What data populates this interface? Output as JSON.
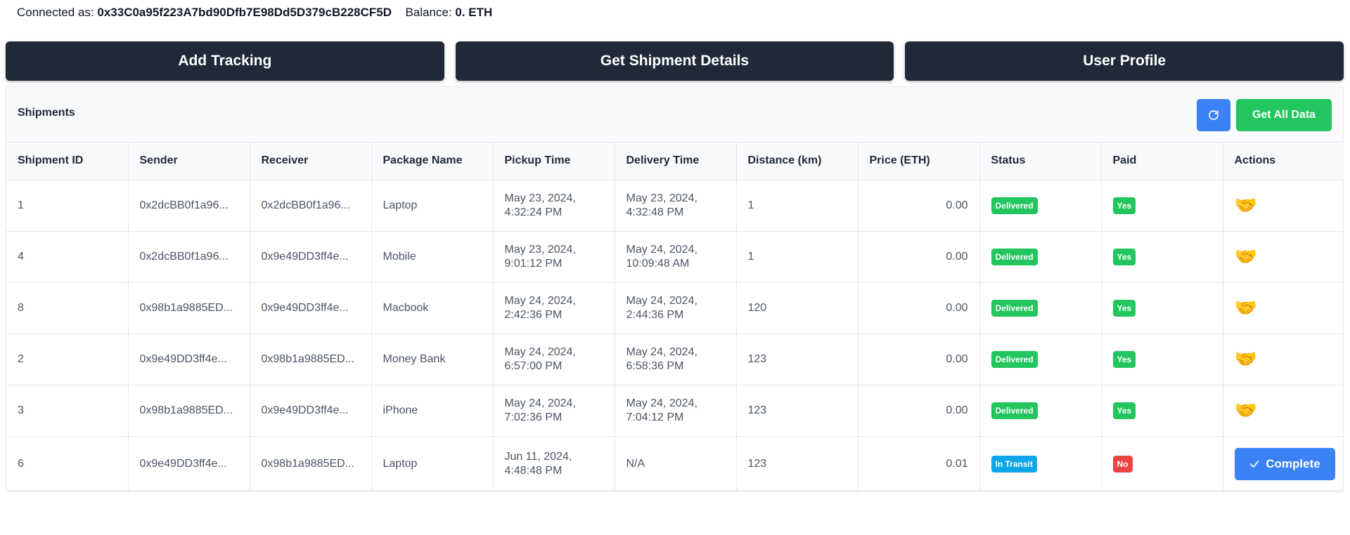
{
  "header": {
    "connected_label": "Connected as:",
    "address": "0x33C0a95f223A7bd90Dfb7E98Dd5D379cB228CF5D",
    "balance_label": "Balance:",
    "balance": "0. ETH"
  },
  "nav": {
    "add_tracking": "Add Tracking",
    "get_shipment_details": "Get Shipment Details",
    "user_profile": "User Profile"
  },
  "panel": {
    "title": "Shipments",
    "refresh_icon": "refresh-icon",
    "get_all_label": "Get All Data"
  },
  "table": {
    "headers": [
      "Shipment ID",
      "Sender",
      "Receiver",
      "Package Name",
      "Pickup Time",
      "Delivery Time",
      "Distance (km)",
      "Price (ETH)",
      "Status",
      "Paid",
      "Actions"
    ],
    "rows": [
      {
        "id": "1",
        "sender": "0x2dcBB0f1a96...",
        "receiver": "0x2dcBB0f1a96...",
        "package": "Laptop",
        "pickup": "May 23, 2024, 4:32:24 PM",
        "delivery": "May 23, 2024, 4:32:48 PM",
        "distance": "1",
        "price": "0.00",
        "status": "Delivered",
        "paid": "Yes",
        "action": "🤝"
      },
      {
        "id": "4",
        "sender": "0x2dcBB0f1a96...",
        "receiver": "0x9e49DD3ff4e...",
        "package": "Mobile",
        "pickup": "May 23, 2024, 9:01:12 PM",
        "delivery": "May 24, 2024, 10:09:48 AM",
        "distance": "1",
        "price": "0.00",
        "status": "Delivered",
        "paid": "Yes",
        "action": "🤝"
      },
      {
        "id": "8",
        "sender": "0x98b1a9885ED...",
        "receiver": "0x9e49DD3ff4e...",
        "package": "Macbook",
        "pickup": "May 24, 2024, 2:42:36 PM",
        "delivery": "May 24, 2024, 2:44:36 PM",
        "distance": "120",
        "price": "0.00",
        "status": "Delivered",
        "paid": "Yes",
        "action": "🤝"
      },
      {
        "id": "2",
        "sender": "0x9e49DD3ff4e...",
        "receiver": "0x98b1a9885ED...",
        "package": "Money Bank",
        "pickup": "May 24, 2024, 6:57:00 PM",
        "delivery": "May 24, 2024, 6:58:36 PM",
        "distance": "123",
        "price": "0.00",
        "status": "Delivered",
        "paid": "Yes",
        "action": "🤝"
      },
      {
        "id": "3",
        "sender": "0x98b1a9885ED...",
        "receiver": "0x9e49DD3ff4e...",
        "package": "iPhone",
        "pickup": "May 24, 2024, 7:02:36 PM",
        "delivery": "May 24, 2024, 7:04:12 PM",
        "distance": "123",
        "price": "0.00",
        "status": "Delivered",
        "paid": "Yes",
        "action": "🤝"
      },
      {
        "id": "6",
        "sender": "0x9e49DD3ff4e...",
        "receiver": "0x98b1a9885ED...",
        "package": "Laptop",
        "pickup": "Jun 11, 2024, 4:48:48 PM",
        "delivery": "N/A",
        "distance": "123",
        "price": "0.01",
        "status": "In Transit",
        "paid": "No",
        "action": "Complete"
      }
    ]
  },
  "colors": {
    "nav_bg": "#1f2937",
    "accent_blue": "#3b82f6",
    "success_green": "#22c55e",
    "transit_blue": "#0ea5e9",
    "danger_red": "#ef4444"
  }
}
